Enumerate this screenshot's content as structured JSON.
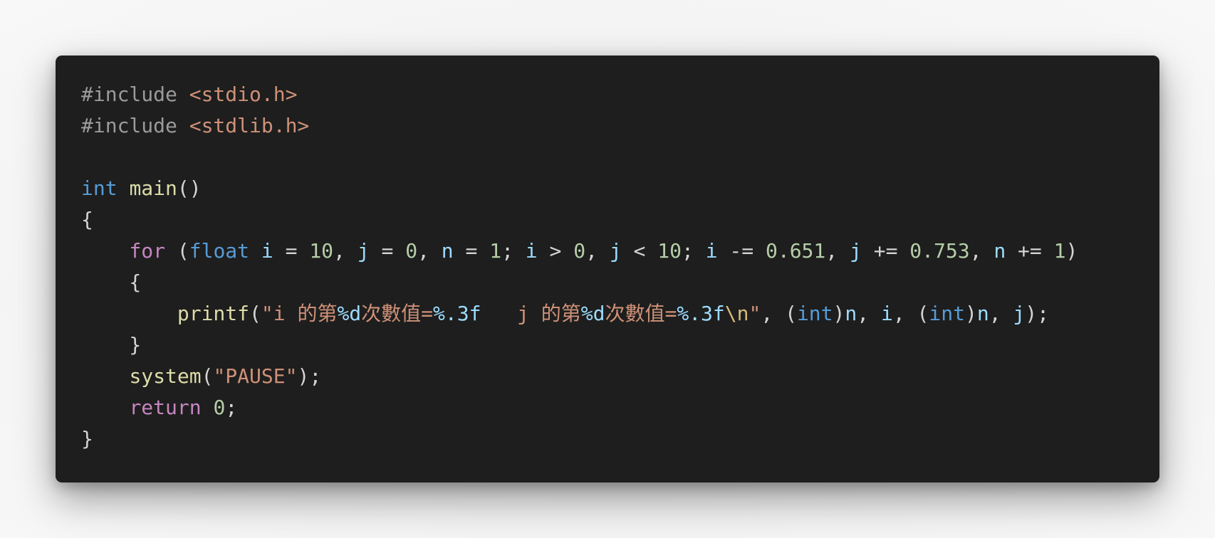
{
  "colors": {
    "editor_background": "#1e1e1e",
    "preprocessor": "#9b9b9b",
    "string": "#ce9178",
    "type_keyword": "#569cd6",
    "function": "#dcdcaa",
    "control_keyword": "#c586c0",
    "variable": "#9cdcfe",
    "number": "#b5cea8",
    "escape": "#d7ba7d",
    "punctuation": "#d4d4d4"
  },
  "code": {
    "language": "c",
    "lines": [
      [
        {
          "t": "#include ",
          "k": "pre"
        },
        {
          "t": "<stdio.h>",
          "k": "str"
        }
      ],
      [
        {
          "t": "#include ",
          "k": "pre"
        },
        {
          "t": "<stdlib.h>",
          "k": "str"
        }
      ],
      [],
      [
        {
          "t": "int",
          "k": "type"
        },
        {
          "t": " ",
          "k": "punc"
        },
        {
          "t": "main",
          "k": "func"
        },
        {
          "t": "()",
          "k": "punc"
        }
      ],
      [
        {
          "t": "{",
          "k": "punc"
        }
      ],
      [
        {
          "t": "    ",
          "k": "punc"
        },
        {
          "t": "for",
          "k": "kw"
        },
        {
          "t": " (",
          "k": "punc"
        },
        {
          "t": "float",
          "k": "type"
        },
        {
          "t": " ",
          "k": "punc"
        },
        {
          "t": "i",
          "k": "var"
        },
        {
          "t": " = ",
          "k": "punc"
        },
        {
          "t": "10",
          "k": "num"
        },
        {
          "t": ", ",
          "k": "punc"
        },
        {
          "t": "j",
          "k": "var"
        },
        {
          "t": " = ",
          "k": "punc"
        },
        {
          "t": "0",
          "k": "num"
        },
        {
          "t": ", ",
          "k": "punc"
        },
        {
          "t": "n",
          "k": "var"
        },
        {
          "t": " = ",
          "k": "punc"
        },
        {
          "t": "1",
          "k": "num"
        },
        {
          "t": "; ",
          "k": "punc"
        },
        {
          "t": "i",
          "k": "var"
        },
        {
          "t": " > ",
          "k": "punc"
        },
        {
          "t": "0",
          "k": "num"
        },
        {
          "t": ", ",
          "k": "punc"
        },
        {
          "t": "j",
          "k": "var"
        },
        {
          "t": " < ",
          "k": "punc"
        },
        {
          "t": "10",
          "k": "num"
        },
        {
          "t": "; ",
          "k": "punc"
        },
        {
          "t": "i",
          "k": "var"
        },
        {
          "t": " -= ",
          "k": "punc"
        },
        {
          "t": "0.651",
          "k": "num"
        },
        {
          "t": ", ",
          "k": "punc"
        },
        {
          "t": "j",
          "k": "var"
        },
        {
          "t": " += ",
          "k": "punc"
        },
        {
          "t": "0.753",
          "k": "num"
        },
        {
          "t": ", ",
          "k": "punc"
        },
        {
          "t": "n",
          "k": "var"
        },
        {
          "t": " += ",
          "k": "punc"
        },
        {
          "t": "1",
          "k": "num"
        },
        {
          "t": ")",
          "k": "punc"
        }
      ],
      [
        {
          "t": "    {",
          "k": "punc"
        }
      ],
      [
        {
          "t": "        ",
          "k": "punc"
        },
        {
          "t": "printf",
          "k": "func"
        },
        {
          "t": "(",
          "k": "punc"
        },
        {
          "t": "\"i 的第",
          "k": "str"
        },
        {
          "t": "%d",
          "k": "fmt"
        },
        {
          "t": "次數值=",
          "k": "str"
        },
        {
          "t": "%.3f",
          "k": "fmt"
        },
        {
          "t": "   j 的第",
          "k": "str"
        },
        {
          "t": "%d",
          "k": "fmt"
        },
        {
          "t": "次數值=",
          "k": "str"
        },
        {
          "t": "%.3f",
          "k": "fmt"
        },
        {
          "t": "\\n",
          "k": "esc"
        },
        {
          "t": "\"",
          "k": "str"
        },
        {
          "t": ", (",
          "k": "punc"
        },
        {
          "t": "int",
          "k": "type"
        },
        {
          "t": ")",
          "k": "punc"
        },
        {
          "t": "n",
          "k": "var"
        },
        {
          "t": ", ",
          "k": "punc"
        },
        {
          "t": "i",
          "k": "var"
        },
        {
          "t": ", (",
          "k": "punc"
        },
        {
          "t": "int",
          "k": "type"
        },
        {
          "t": ")",
          "k": "punc"
        },
        {
          "t": "n",
          "k": "var"
        },
        {
          "t": ", ",
          "k": "punc"
        },
        {
          "t": "j",
          "k": "var"
        },
        {
          "t": ");",
          "k": "punc"
        }
      ],
      [
        {
          "t": "    }",
          "k": "punc"
        }
      ],
      [
        {
          "t": "    ",
          "k": "punc"
        },
        {
          "t": "system",
          "k": "func"
        },
        {
          "t": "(",
          "k": "punc"
        },
        {
          "t": "\"PAUSE\"",
          "k": "str"
        },
        {
          "t": ");",
          "k": "punc"
        }
      ],
      [
        {
          "t": "    ",
          "k": "punc"
        },
        {
          "t": "return",
          "k": "kw"
        },
        {
          "t": " ",
          "k": "punc"
        },
        {
          "t": "0",
          "k": "num"
        },
        {
          "t": ";",
          "k": "punc"
        }
      ],
      [
        {
          "t": "}",
          "k": "punc"
        }
      ]
    ]
  }
}
